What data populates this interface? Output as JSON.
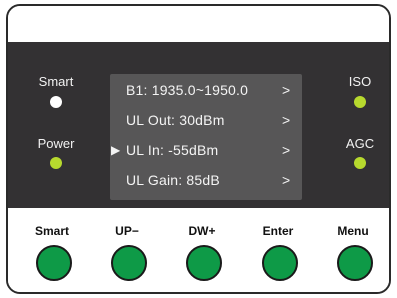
{
  "indicators": {
    "smart": {
      "label": "Smart",
      "led_color": "#ffffff"
    },
    "power": {
      "label": "Power",
      "led_color": "#b7d92e"
    },
    "iso": {
      "label": "ISO",
      "led_color": "#b7d92e"
    },
    "agc": {
      "label": "AGC",
      "led_color": "#b7d92e"
    }
  },
  "display": {
    "rows": [
      {
        "text": "B1: 1935.0~1950.0",
        "arrow": ">",
        "selected": false
      },
      {
        "text": "UL Out: 30dBm",
        "arrow": ">",
        "selected": false
      },
      {
        "text": "UL In: -55dBm",
        "arrow": ">",
        "selected": true,
        "marker": "▶"
      },
      {
        "text": "UL Gain: 85dB",
        "arrow": ">",
        "selected": false
      }
    ]
  },
  "buttons": [
    {
      "label": "Smart"
    },
    {
      "label": "UP−"
    },
    {
      "label": "DW+"
    },
    {
      "label": "Enter"
    },
    {
      "label": "Menu"
    }
  ],
  "colors": {
    "panel": "#333133",
    "lcd": "#575657",
    "button_green": "#0e9a47"
  }
}
